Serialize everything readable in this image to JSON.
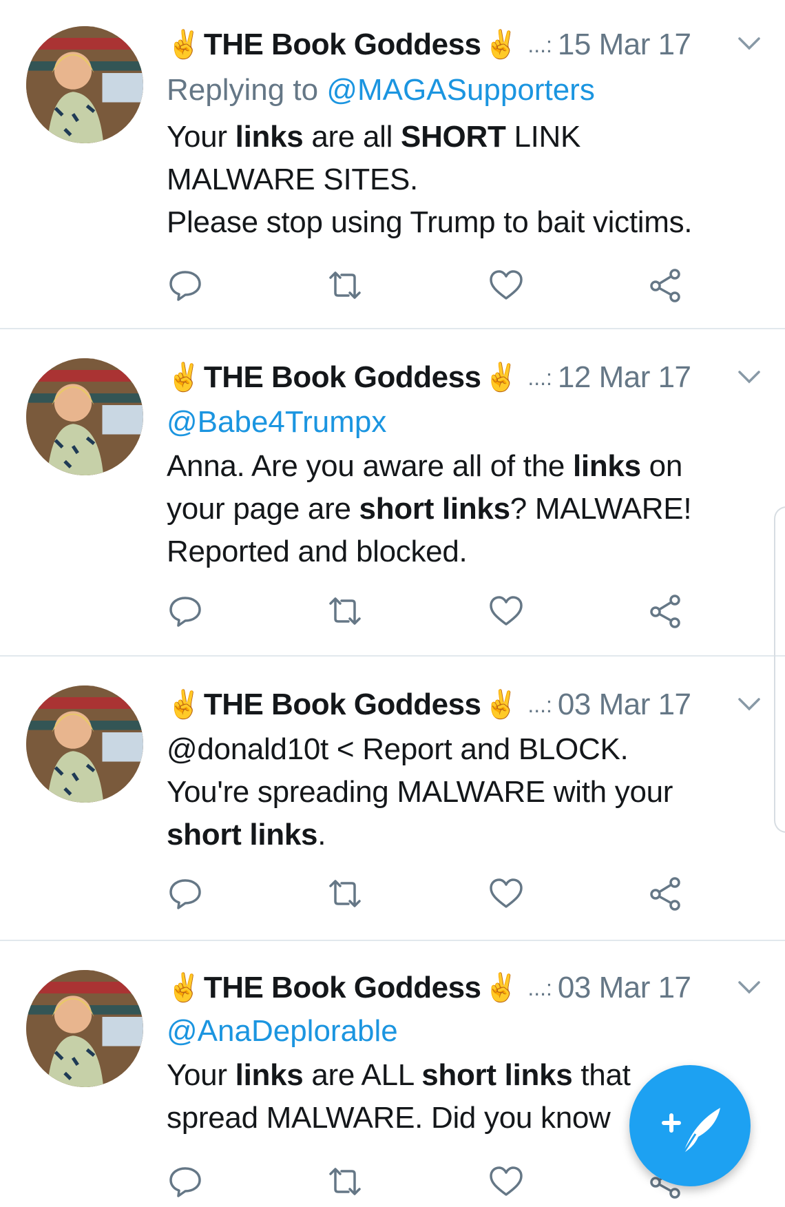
{
  "tweets": [
    {
      "emoji_left": "✌",
      "name": "THE Book Goddess",
      "emoji_right": "✌",
      "dots": "...:",
      "date": "15 Mar 17",
      "reply_prefix": "Replying to ",
      "reply_handle": "@MAGASupporters",
      "lines": [
        [
          {
            "t": "Your "
          },
          {
            "t": "links",
            "b": true
          },
          {
            "t": " are all "
          },
          {
            "t": "SHORT",
            "b": true
          },
          {
            "t": " LINK"
          }
        ],
        [
          {
            "t": "MALWARE SITES."
          }
        ],
        [
          {
            "t": "Please stop using Trump to bait victims."
          }
        ]
      ]
    },
    {
      "emoji_left": "✌",
      "name": "THE Book Goddess",
      "emoji_right": "✌",
      "dots": "...:",
      "date": "12 Mar 17",
      "handle": "@Babe4Trumpx",
      "lines": [
        [
          {
            "t": "Anna.  Are you aware all of the "
          },
          {
            "t": "links",
            "b": true
          },
          {
            "t": " on"
          }
        ],
        [
          {
            "t": "your page are "
          },
          {
            "t": "short links",
            "b": true
          },
          {
            "t": "?  MALWARE!"
          }
        ],
        [
          {
            "t": "Reported and blocked."
          }
        ]
      ]
    },
    {
      "emoji_left": "✌",
      "name": "THE Book Goddess",
      "emoji_right": "✌",
      "dots": "...:",
      "date": "03 Mar 17",
      "lines": [
        [
          {
            "t": "@donald10t < Report and BLOCK."
          }
        ],
        [
          {
            "t": "You're spreading MALWARE with your"
          }
        ],
        [
          {
            "t": "short links",
            "b": true
          },
          {
            "t": "."
          }
        ]
      ]
    },
    {
      "emoji_left": "✌",
      "name": "THE Book Goddess",
      "emoji_right": "✌",
      "dots": "...:",
      "date": "03 Mar 17",
      "handle": "@AnaDeplorable",
      "lines": [
        [
          {
            "t": "Your "
          },
          {
            "t": "links",
            "b": true
          },
          {
            "t": " are ALL "
          },
          {
            "t": "short links",
            "b": true
          },
          {
            "t": " that"
          }
        ],
        [
          {
            "t": "spread MALWARE.  Did you know"
          }
        ]
      ]
    }
  ],
  "icons": {
    "reply": "reply-icon",
    "retweet": "retweet-icon",
    "like": "heart-icon",
    "share": "share-icon",
    "chevron": "chevron-down-icon",
    "compose": "compose-tweet-icon"
  },
  "colors": {
    "link": "#1b95e0",
    "muted": "#657786",
    "fab": "#1da1f2",
    "separator": "#e1e8ed"
  }
}
